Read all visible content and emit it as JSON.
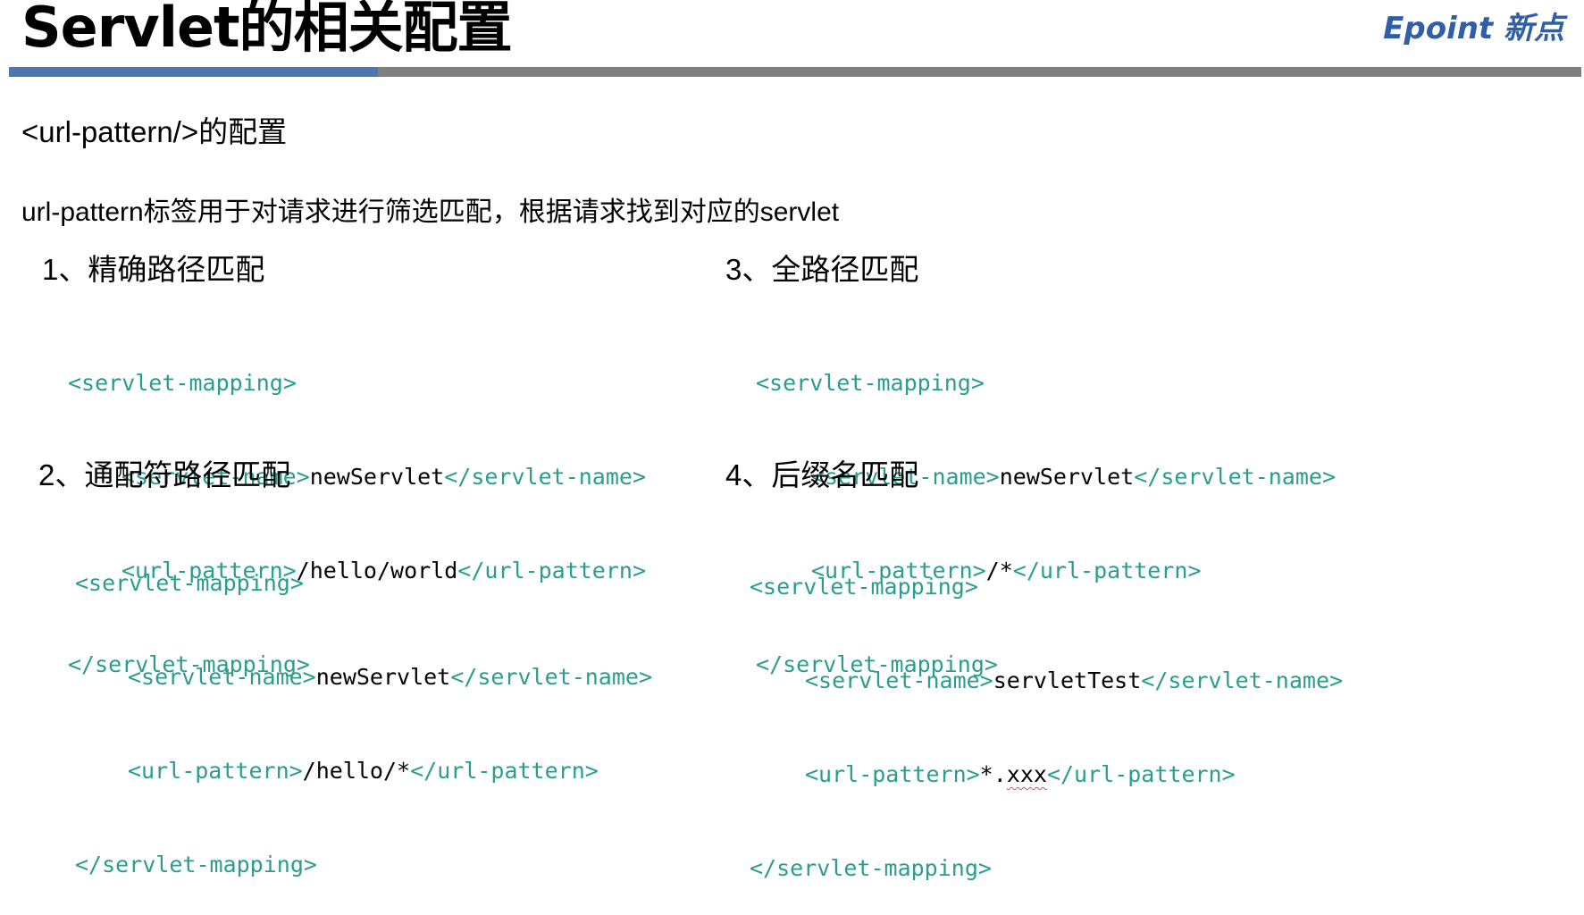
{
  "title": "Servlet的相关配置",
  "logo": "Epoint 新点",
  "subheading": "<url-pattern/>的配置",
  "intro": "url-pattern标签用于对请求进行筛选匹配，根据请求找到对应的servlet",
  "sections": [
    {
      "heading": "1、精确路径匹配",
      "open_tag": "<servlet-mapping>",
      "name_open": "<servlet-name>",
      "name_value": "newServlet",
      "name_close": "</servlet-name>",
      "pattern_open": "<url-pattern>",
      "pattern_value": "/hello/world",
      "pattern_close": "</url-pattern>",
      "close_tag": "</servlet-mapping>"
    },
    {
      "heading": "2、通配符路径匹配",
      "open_tag": "<servlet-mapping>",
      "name_open": "<servlet-name>",
      "name_value": "newServlet",
      "name_close": "</servlet-name>",
      "pattern_open": "<url-pattern>",
      "pattern_value": "/hello/*",
      "pattern_close": "</url-pattern>",
      "close_tag": "</servlet-mapping>"
    },
    {
      "heading": "3、全路径匹配",
      "open_tag": "<servlet-mapping>",
      "name_open": "<servlet-name>",
      "name_value": "newServlet",
      "name_close": "</servlet-name>",
      "pattern_open": "<url-pattern>",
      "pattern_value": "/*",
      "pattern_close": "</url-pattern>",
      "close_tag": "</servlet-mapping>"
    },
    {
      "heading": "4、后缀名匹配",
      "open_tag": "<servlet-mapping>",
      "name_open": "<servlet-name>",
      "name_value": "servletTest",
      "name_close": "</servlet-name>",
      "pattern_open": "<url-pattern>",
      "pattern_value_prefix": "*.",
      "pattern_value_suffix": "xxx",
      "pattern_close": "</url-pattern>",
      "close_tag": "</servlet-mapping>"
    }
  ],
  "colors": {
    "tag": "#2a9d8f",
    "divider_blue": "#4f77ad",
    "divider_gray": "#808080",
    "logo": "#2f5fa8"
  }
}
